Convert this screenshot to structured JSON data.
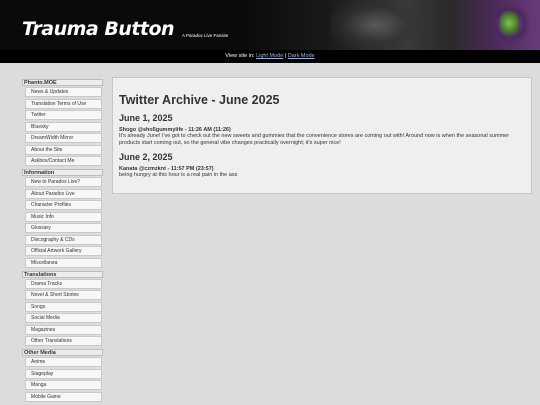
{
  "header": {
    "title": "Trauma Button",
    "subtitle": "A Paradox Live Fansite"
  },
  "modebar": {
    "prefix": "View site in:",
    "light_mode": "Light Mode",
    "separator": "|",
    "dark_mode": "Dark Mode"
  },
  "sidebar": {
    "groups": [
      {
        "heading": "Phanto.MOE",
        "items": [
          "News & Updates",
          "Translation Terms of Use",
          "Twitter",
          "Bluesky",
          "DreamWidth Mirror",
          "About the Site",
          "Askbox/Contact Me"
        ]
      },
      {
        "heading": "Information",
        "items": [
          "New to Paradox Live?",
          "About Paradox Live",
          "Character Profiles",
          "Music Info",
          "Glossary",
          "Discography & CDs",
          "Official Artwork Gallery",
          "Miscellanea"
        ]
      },
      {
        "heading": "Translations",
        "items": [
          "Drama Tracks",
          "Novel & Short Stories",
          "Songs",
          "Social Media",
          "Magazines",
          "Other Translations"
        ]
      },
      {
        "heading": "Other Media",
        "items": [
          "Anime",
          "Stageplay",
          "Manga",
          "Mobile Game"
        ]
      }
    ]
  },
  "main": {
    "title": "Twitter Archive - June 2025",
    "days": [
      {
        "date": "June 1, 2025",
        "author": "Shogo @sho5gummylife - 11:26 AM (11:26)",
        "text": "It's already June! I've got to check out the new sweets and gummies that the convenience stores are coming out with! Around now is when the seasonal summer products start coming out, so the general vibe changes practically overnight; it's super nice!"
      },
      {
        "date": "June 2, 2025",
        "author": "Kanata @czmzknt - 11:57 PM (23:57)",
        "text": "being hungry at this hour is a real pain in the ass"
      }
    ]
  }
}
